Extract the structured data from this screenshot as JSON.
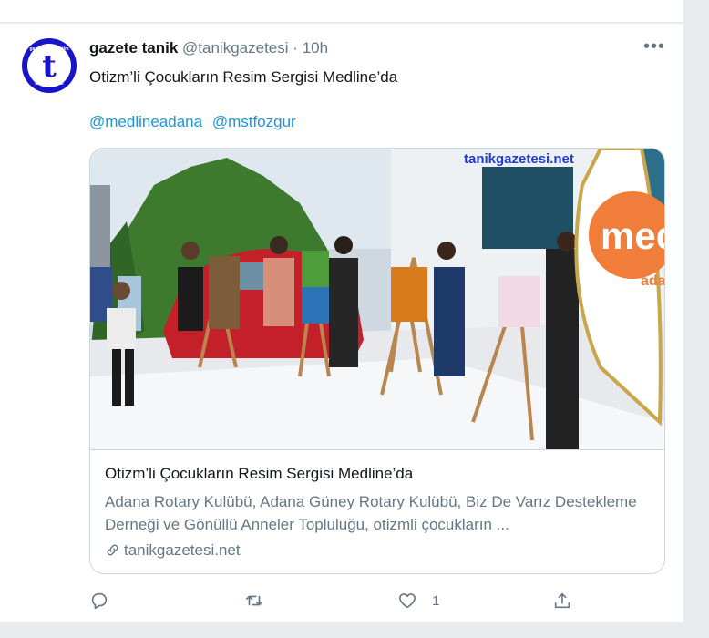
{
  "tweet": {
    "display_name": "gazete tanik",
    "handle": "@tanikgazetesi",
    "separator": "·",
    "time": "10h",
    "text": "Otizm’li Çocukların Resim Sergisi Medline’da",
    "mentions": [
      "@medlineadana",
      "@mstfozgur"
    ],
    "avatar": {
      "letter": "t",
      "arc_top": "gazete ve yönetim",
      "arc_bottom": "tanikgazetesi"
    }
  },
  "card": {
    "image_watermark": "tanikgazetesi.net",
    "flag_text": "medl",
    "flag_text2": "ada",
    "title": "Otizm’li Çocukların Resim Sergisi Medline’da",
    "description": "Adana Rotary Kulübü, Adana Güney Rotary Kulübü, Biz De Varız Destekleme Derneği ve Gönüllü Anneler Topluluğu, otizmli çocukların ...",
    "domain": "tanikgazetesi.net"
  },
  "actions": {
    "reply_count": "",
    "retweet_count": "",
    "like_count": "1"
  },
  "colors": {
    "link": "#1b95e0",
    "muted": "#657786",
    "text": "#14171a",
    "avatar": "#1a14c8",
    "flag_orange": "#f07d3a"
  }
}
